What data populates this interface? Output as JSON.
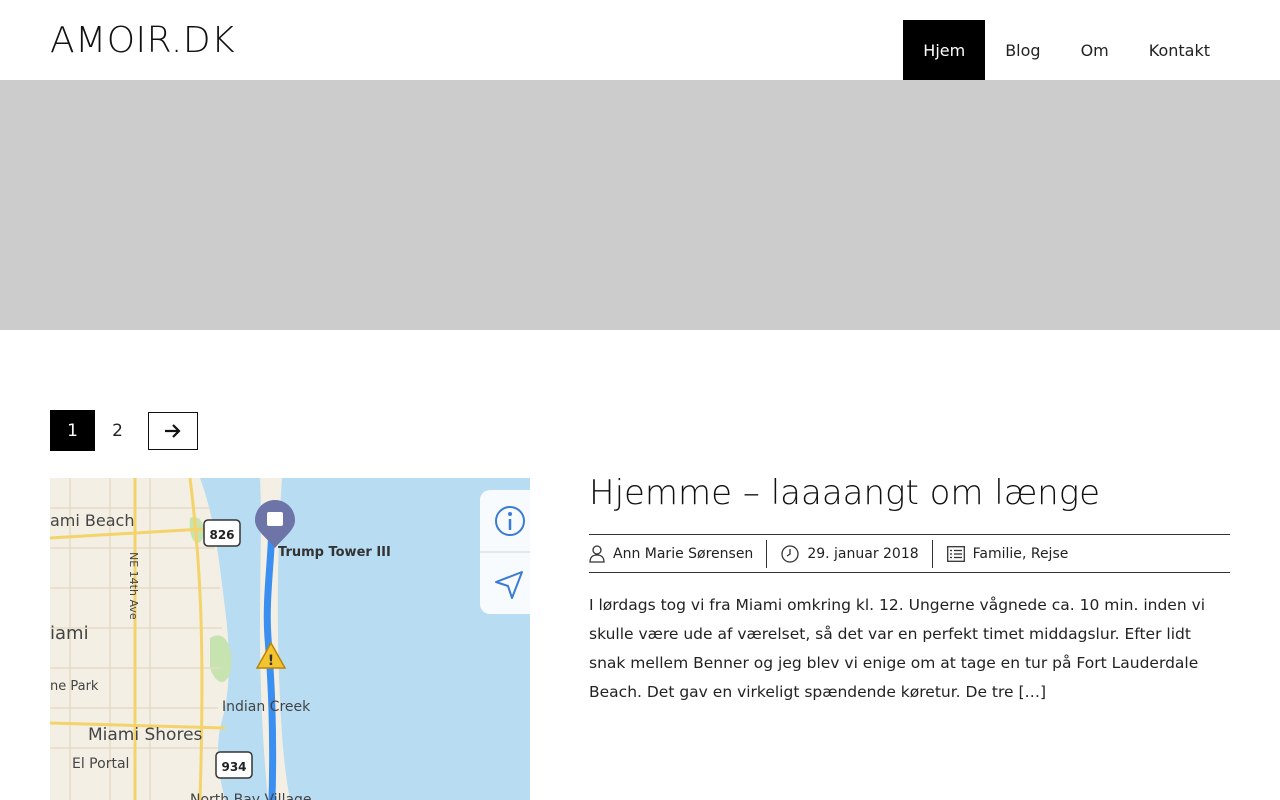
{
  "site": {
    "logo": "AMOIR.DK"
  },
  "nav": {
    "items": [
      {
        "label": "Hjem",
        "active": true
      },
      {
        "label": "Blog"
      },
      {
        "label": "Om"
      },
      {
        "label": "Kontakt"
      }
    ]
  },
  "pagination": {
    "current": "1",
    "next_page": "2",
    "next_icon": "arrow-right-icon"
  },
  "post": {
    "title": "Hjemme – laaaangt om længe",
    "author": "Ann Marie Sørensen",
    "date": "29. januar 2018",
    "categories": [
      "Familie",
      "Rejse"
    ],
    "category_separator": ", ",
    "excerpt": "I lørdags tog vi fra Miami omkring kl. 12. Ungerne vågnede ca. 10 min. inden vi skulle være ude af værelset, så det var en perfekt timet middagslur. Efter lidt snak mellem Benner og jeg blev vi enige om at tage en tur på Fort Lauderdale Beach. Det gav en virkeligt spændende køretur. De tre […]",
    "thumbnail": {
      "labels": {
        "miami_beach": "ami Beach",
        "trump_tower": "Trump Tower III",
        "ne_14th_ave": "NE 14th Ave",
        "miami": "iami",
        "park": "ne Park",
        "indian_creek": "Indian Creek",
        "miami_shores": "Miami Shores",
        "el_portal": "El Portal",
        "north_bay_village": "North Bay Village",
        "route_826": "826",
        "route_934": "934"
      },
      "colors": {
        "water": "#b8dcf2",
        "land": "#f3efe4",
        "route": "#3a8ff0",
        "major_road": "#f4d36b",
        "park": "#c6e3b0"
      }
    }
  }
}
